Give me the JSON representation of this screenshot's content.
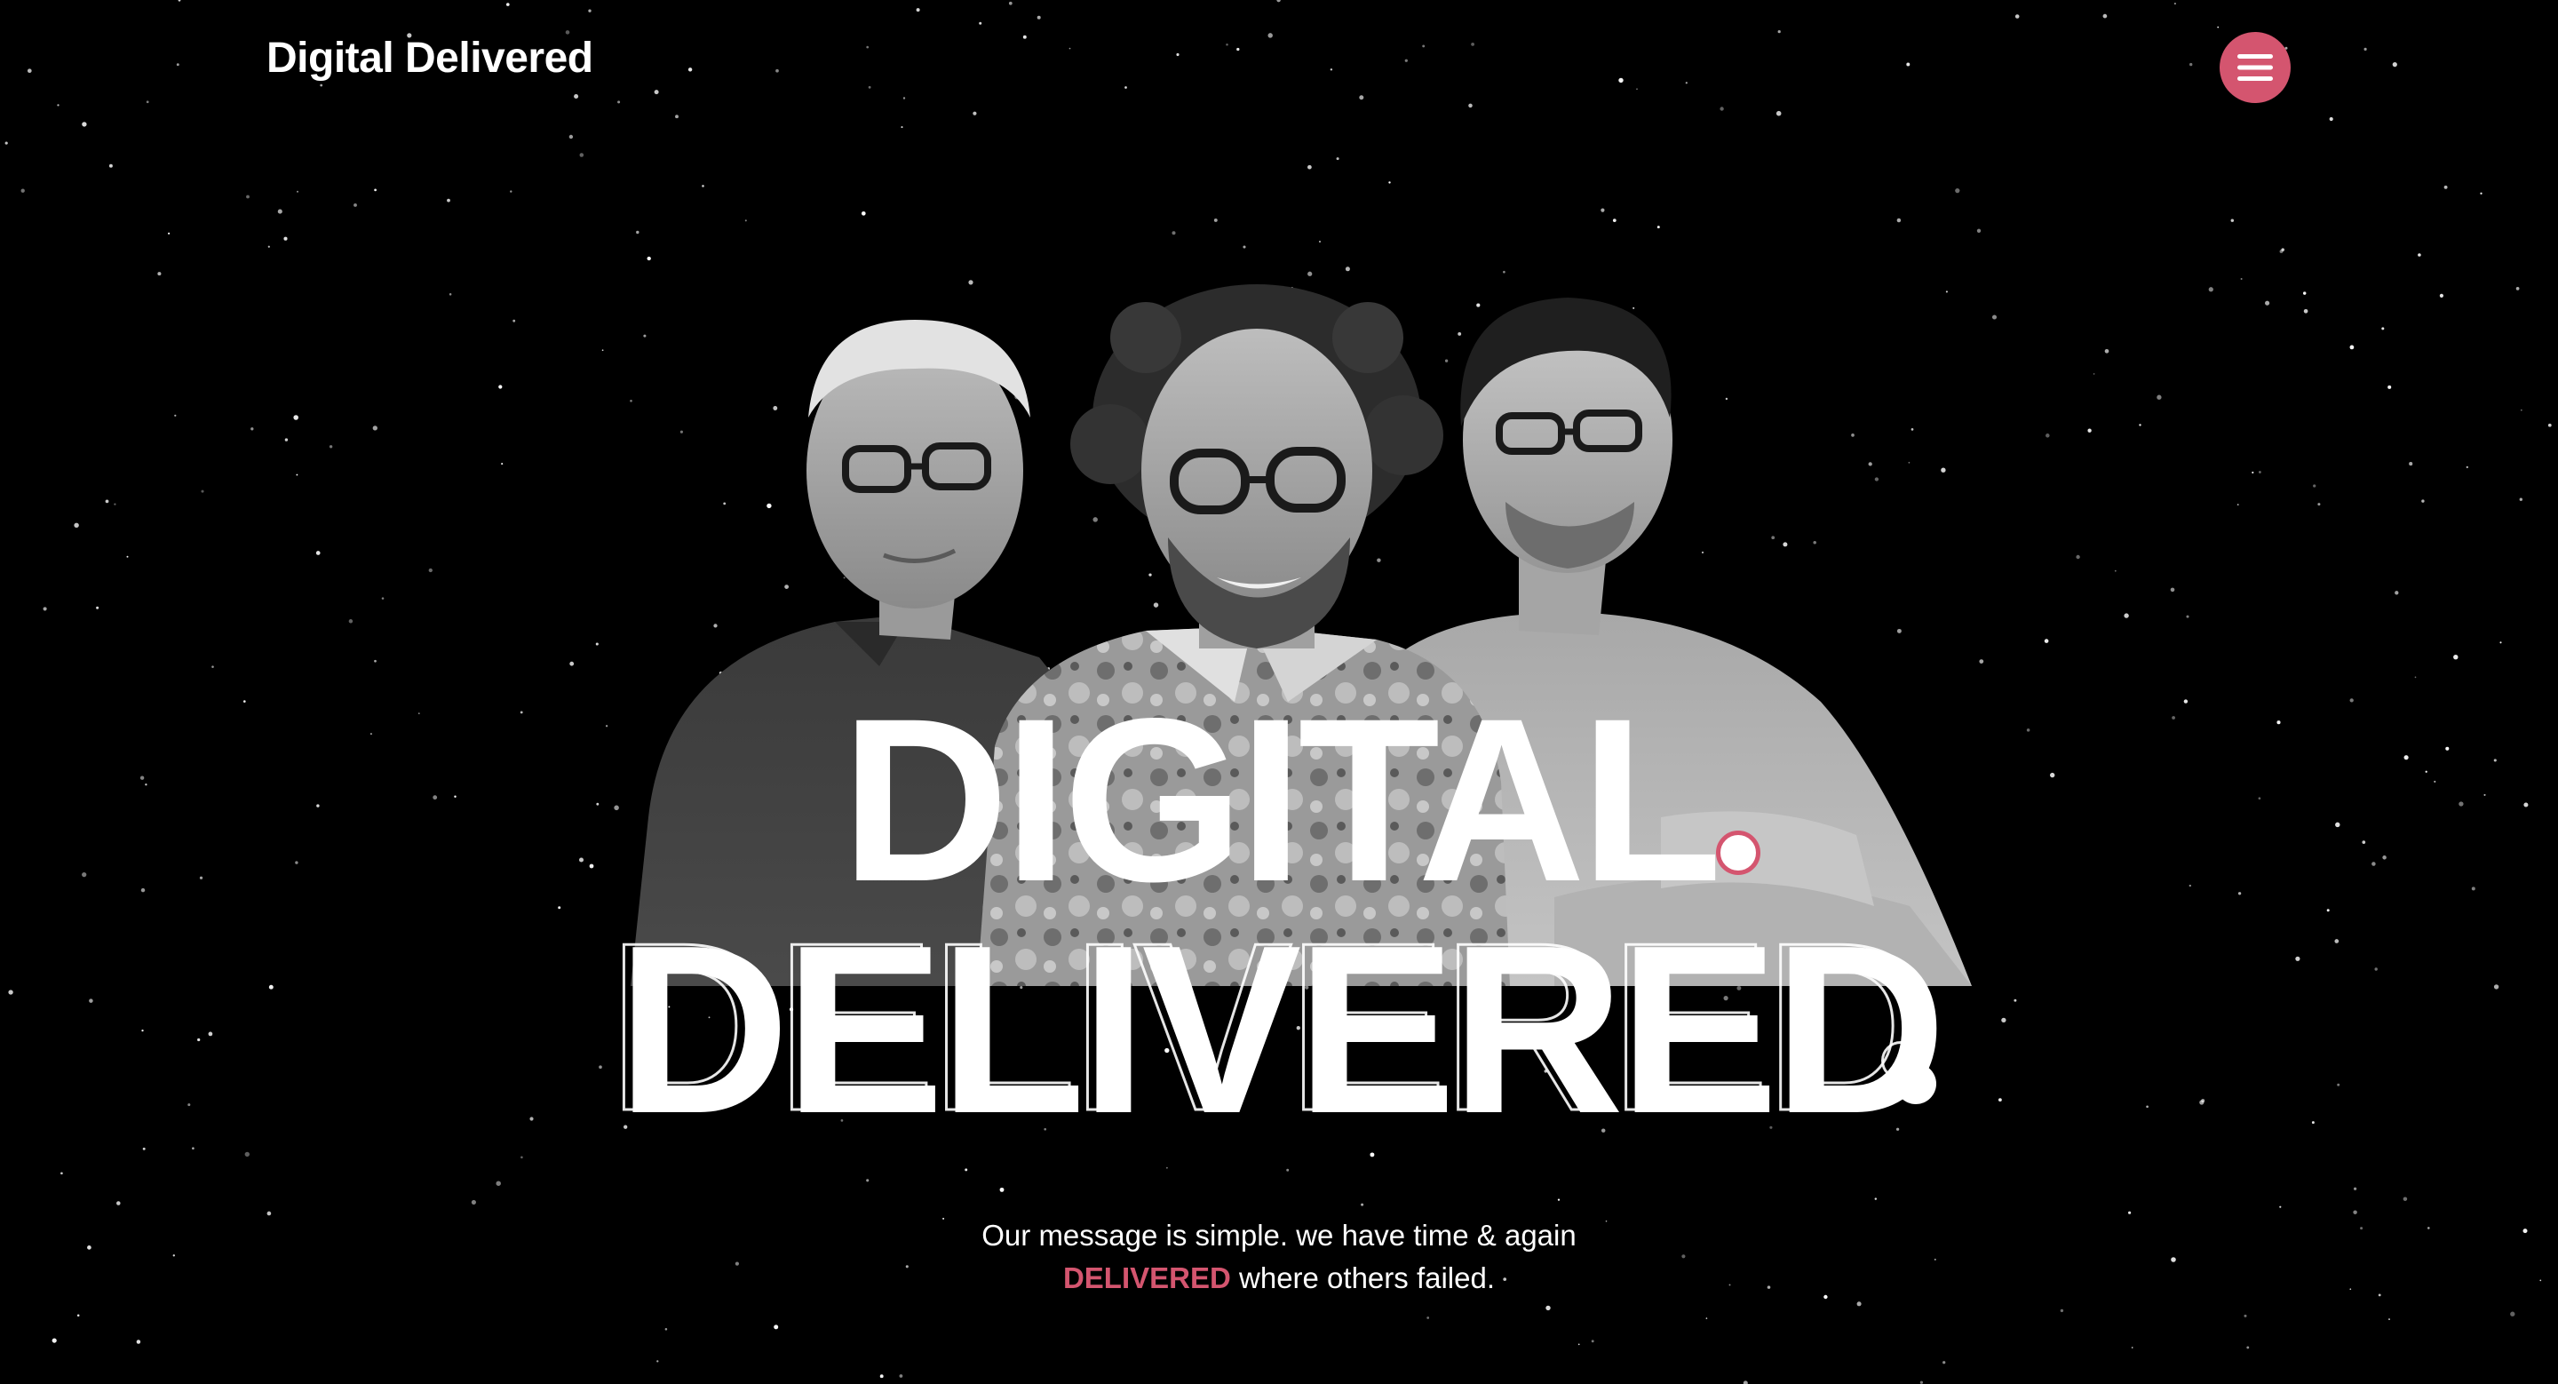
{
  "header": {
    "logo_text": "Digital Delivered",
    "menu_icon": "hamburger-menu-icon"
  },
  "hero": {
    "photo_description_icon": "team-photo",
    "headline_line1": "DIGITAL",
    "headline_line2": "DELIVERED",
    "tagline_line1": "Our message is simple. we have time & again",
    "tagline_accent": "DELIVERED",
    "tagline_rest": " where others failed."
  },
  "colors": {
    "background": "#000000",
    "accent": "#d4556f",
    "text": "#ffffff"
  }
}
